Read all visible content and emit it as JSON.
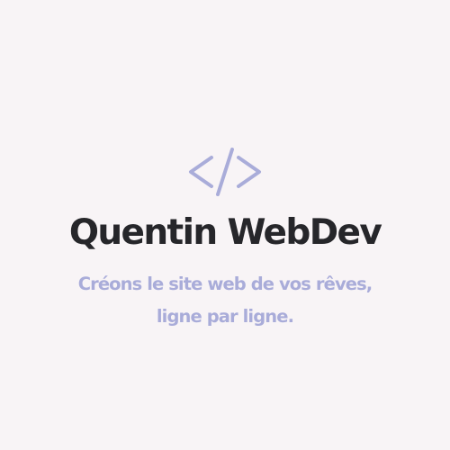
{
  "logo": {
    "icon": "code-brackets-icon",
    "brand_name": "Quentin WebDev",
    "tagline_line1": "Créons le site web de vos rêves,",
    "tagline_line2": "ligne par ligne."
  },
  "colors": {
    "background": "#f8f4f6",
    "brand_text": "#26262a",
    "accent": "#a9acd9"
  }
}
